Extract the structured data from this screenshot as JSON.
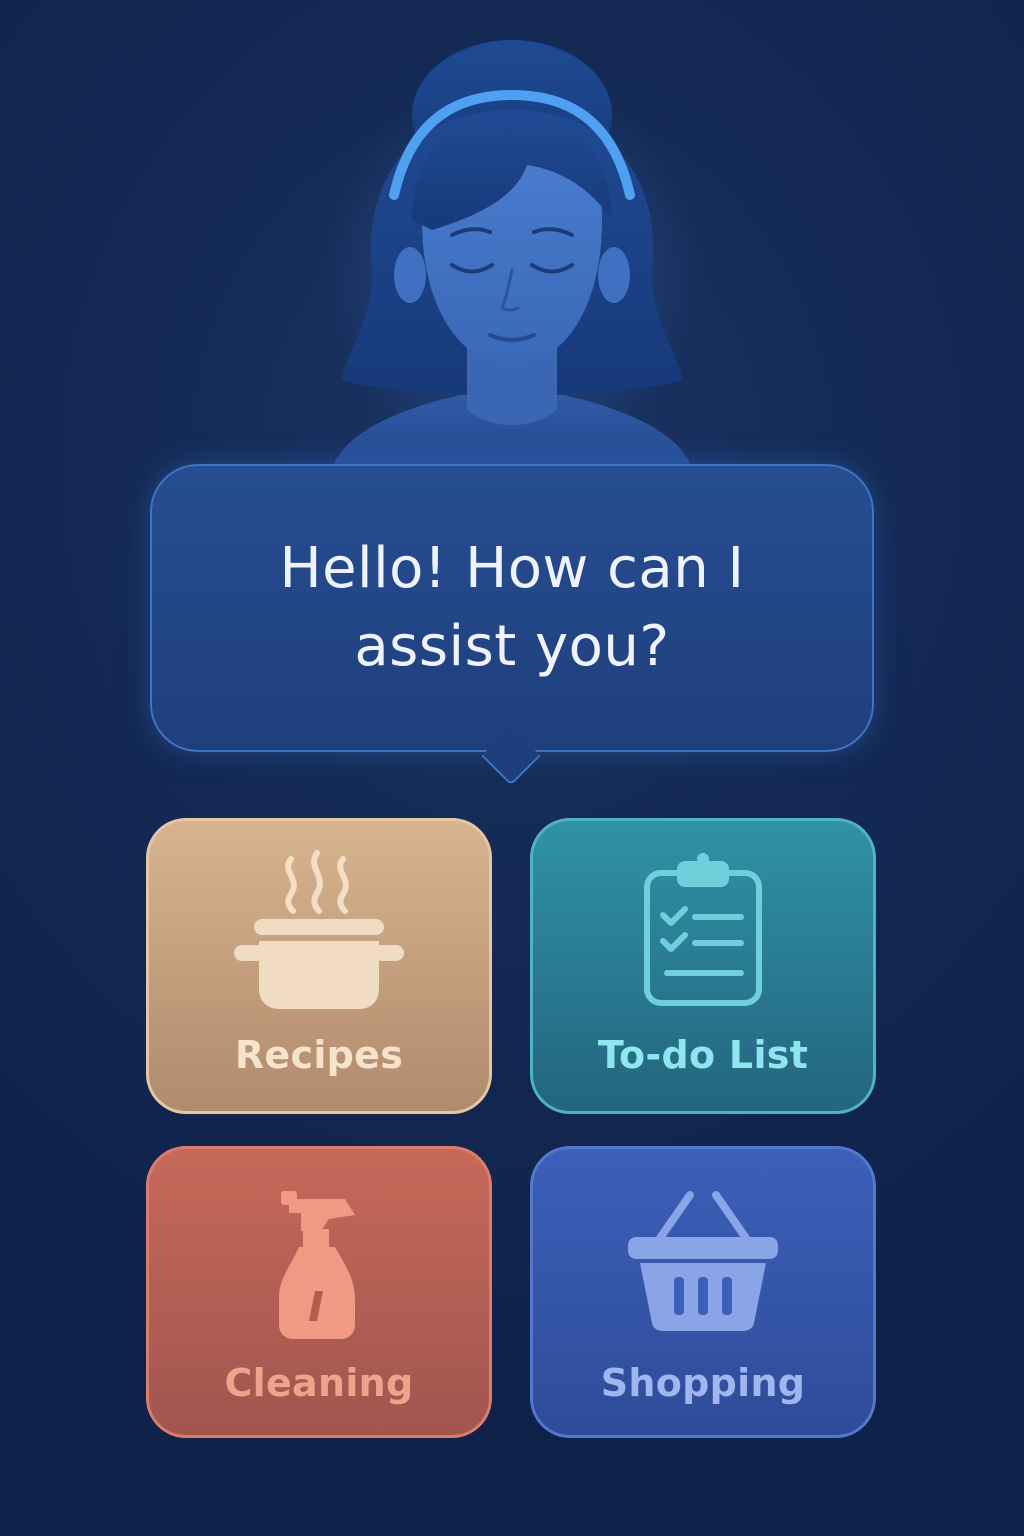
{
  "assistant": {
    "greeting": "Hello! How can I assist you?"
  },
  "tiles": [
    {
      "label": "Recipes",
      "icon": "cooking-pot-icon",
      "color": "#d7b48f"
    },
    {
      "label": "To-do List",
      "icon": "clipboard-checklist-icon",
      "color": "#2f92a6"
    },
    {
      "label": "Cleaning",
      "icon": "spray-bottle-icon",
      "color": "#c7685a"
    },
    {
      "label": "Shopping",
      "icon": "shopping-basket-icon",
      "color": "#3c5fb9"
    }
  ],
  "colors": {
    "background": "#142a55",
    "bubble": "#274d92",
    "bubble_border": "#3f73c6",
    "avatar": "#3b6fc0"
  }
}
